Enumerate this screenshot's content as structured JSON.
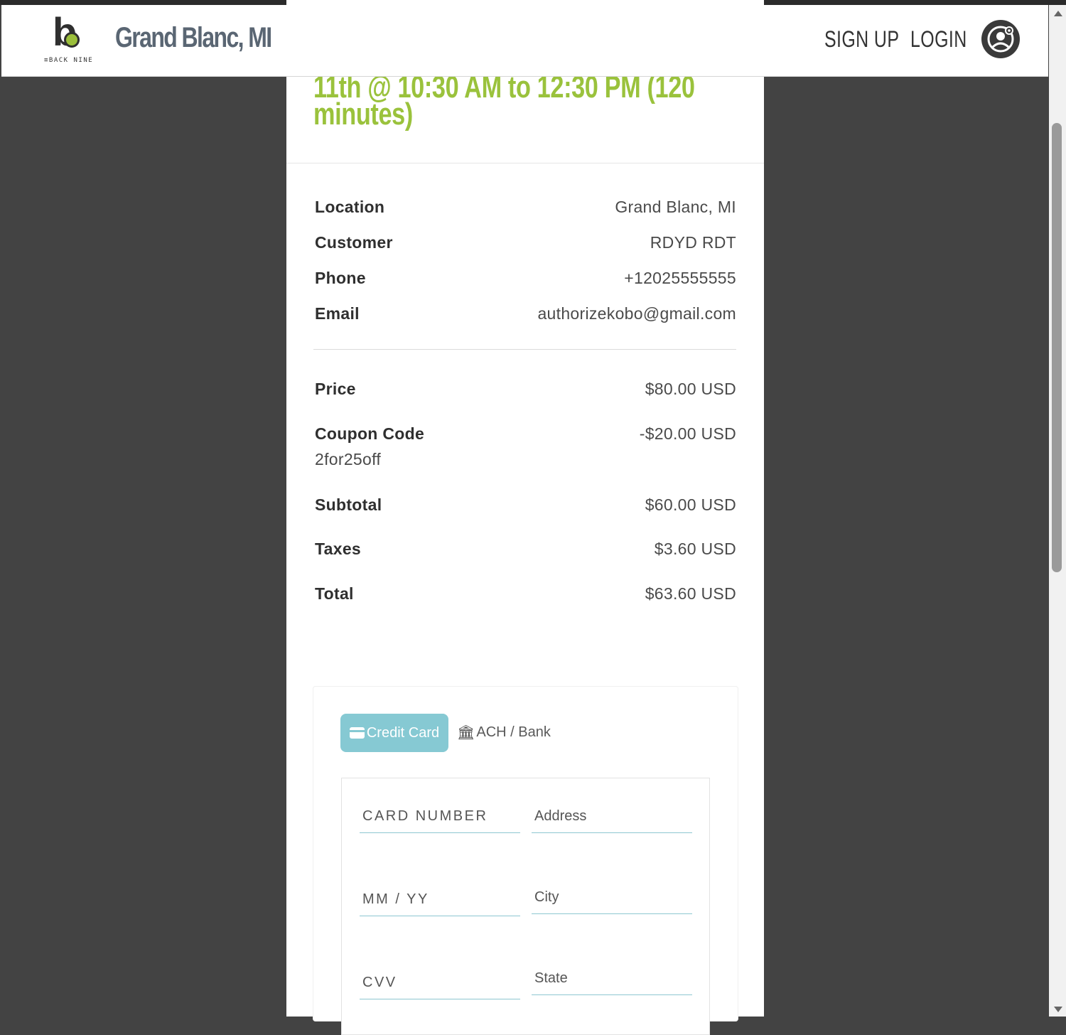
{
  "header": {
    "logo_text": "THE BACK NINE",
    "logo_caption": "≡BACK NINE",
    "title": "Grand Blanc, MI",
    "signup_label": "SIGN UP",
    "login_label": "LOGIN",
    "avatar_icon": "user-avatar-icon"
  },
  "booking": {
    "time_line1": "11th @ 10:30 AM to 12:30 PM (120",
    "time_line2": "minutes)",
    "accent_color": "#9ac23c"
  },
  "details": [
    {
      "label": "Location",
      "value": "Grand Blanc, MI"
    },
    {
      "label": "Customer",
      "value": "RDYD RDT"
    },
    {
      "label": "Phone",
      "value": "+12025555555"
    },
    {
      "label": "Email",
      "value": "authorizekobo@gmail.com"
    }
  ],
  "pricing": {
    "price_label": "Price",
    "price_value": "$80.00 USD",
    "coupon_label": "Coupon Code",
    "coupon_code": "2for25off",
    "coupon_value": "-$20.00 USD",
    "subtotal_label": "Subtotal",
    "subtotal_value": "$60.00 USD",
    "taxes_label": "Taxes",
    "taxes_value": "$3.60 USD",
    "total_label": "Total",
    "total_value": "$63.60 USD"
  },
  "payment": {
    "tabs": [
      {
        "label": "Credit Card",
        "icon": "credit-card-icon",
        "active": true
      },
      {
        "label": "ACH / Bank",
        "icon": "bank-icon",
        "active": false
      }
    ],
    "fields": {
      "card_number": "CARD NUMBER",
      "expiry": "MM / YY",
      "cvv": "CVV",
      "address": "Address",
      "city": "City",
      "state": "State"
    },
    "tab_color": "#86c9d3"
  }
}
